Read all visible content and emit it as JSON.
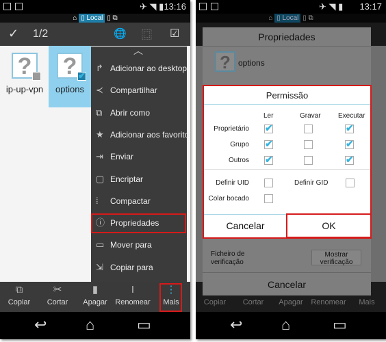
{
  "left": {
    "status": {
      "time": "13:16"
    },
    "location": {
      "home_icon": "home-icon",
      "chip": "Local"
    },
    "toolbar": {
      "count": "1/2"
    },
    "files": [
      {
        "name": "ip-up-vpn",
        "checked": false
      },
      {
        "name": "options",
        "checked": true
      }
    ],
    "menu": [
      {
        "label": "Adicionar ao desktop",
        "icon": "add-desktop-icon"
      },
      {
        "label": "Compartilhar",
        "icon": "share-icon"
      },
      {
        "label": "Abrir como",
        "icon": "open-as-icon"
      },
      {
        "label": "Adicionar aos favoritos",
        "icon": "star-icon"
      },
      {
        "label": "Enviar",
        "icon": "send-icon"
      },
      {
        "label": "Encriptar",
        "icon": "lock-icon"
      },
      {
        "label": "Compactar",
        "icon": "compress-icon"
      },
      {
        "label": "Propriedades",
        "icon": "info-icon",
        "highlighted": true
      },
      {
        "label": "Mover para",
        "icon": "move-icon"
      },
      {
        "label": "Copiar para",
        "icon": "copy-to-icon"
      }
    ],
    "bottom": [
      {
        "label": "Copiar"
      },
      {
        "label": "Cortar"
      },
      {
        "label": "Apagar"
      },
      {
        "label": "Renomear"
      },
      {
        "label": "Mais",
        "highlighted": true
      }
    ]
  },
  "right": {
    "status": {
      "time": "13:17"
    },
    "location": {
      "chip": "Local"
    },
    "properties": {
      "title": "Propriedades",
      "file": "options",
      "checksum_label": "Ficheiro de verificação",
      "checksum_button": "Mostrar verificação",
      "cancel": "Cancelar"
    },
    "permission": {
      "title": "Permissão",
      "columns": [
        "Ler",
        "Gravar",
        "Executar"
      ],
      "rows": [
        {
          "label": "Proprietário",
          "values": [
            true,
            false,
            true
          ]
        },
        {
          "label": "Grupo",
          "values": [
            true,
            false,
            true
          ]
        },
        {
          "label": "Outros",
          "values": [
            true,
            false,
            true
          ]
        }
      ],
      "setuid": {
        "label": "Definir UID",
        "checked": false
      },
      "setgid": {
        "label": "Definir GID",
        "checked": false
      },
      "sticky": {
        "label": "Colar bocado",
        "checked": false
      },
      "cancel": "Cancelar",
      "ok": "OK"
    },
    "bottom": [
      {
        "label": "Copiar"
      },
      {
        "label": "Cortar"
      },
      {
        "label": "Apagar"
      },
      {
        "label": "Renomear"
      },
      {
        "label": "Mais"
      }
    ]
  },
  "colors": {
    "accent": "#35b4df",
    "highlight": "#d61a1a",
    "selection": "#8fd0ee"
  }
}
